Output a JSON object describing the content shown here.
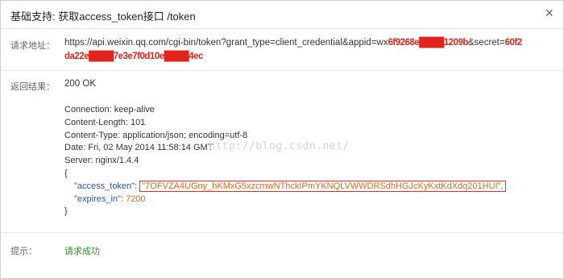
{
  "dialog": {
    "title": "基础支持: 获取access_token接口 /token",
    "close_symbol": "×"
  },
  "request": {
    "label": "请求地址：",
    "url_prefix": "https://api.weixin.qq.com/cgi-bin/token?grant_type=client_credential&appid=wx",
    "url_appid_redacted": "6f9268e████1209b",
    "url_secret_param": "&secret=",
    "url_secret_redacted": "60f2",
    "url_line2_redacted": "da22e████7e3e7f0d10e████4ec"
  },
  "result": {
    "label": "返回结果：",
    "status": "200 OK",
    "headers": [
      "Connection: keep-alive",
      "Content-Length: 101",
      "Content-Type: application/json; encoding=utf-8",
      "Date: Fri, 02 May 2014 11:58:14 GMT",
      "Server: nginx/1.4.4"
    ],
    "open_brace": "{",
    "close_brace": "}",
    "access_token_key": "\"access_token\"",
    "access_token_value": "\"7OFVZA4UGny_hKMxG5xzcmwNThckIPmYKNQLVWWDRSdhHGJcKyKxtKdXdq201HUI\",",
    "expires_in_key": "\"expires_in\"",
    "expires_in_value": "7200",
    "colon": ": "
  },
  "watermark": "http://blog.csdn.net/",
  "hint": {
    "label": "提示：",
    "message": "请求成功"
  },
  "colors": {
    "key": "#3153a0",
    "value": "#d96a16",
    "success": "#2e8b2e",
    "highlight_border": "#e03030"
  }
}
